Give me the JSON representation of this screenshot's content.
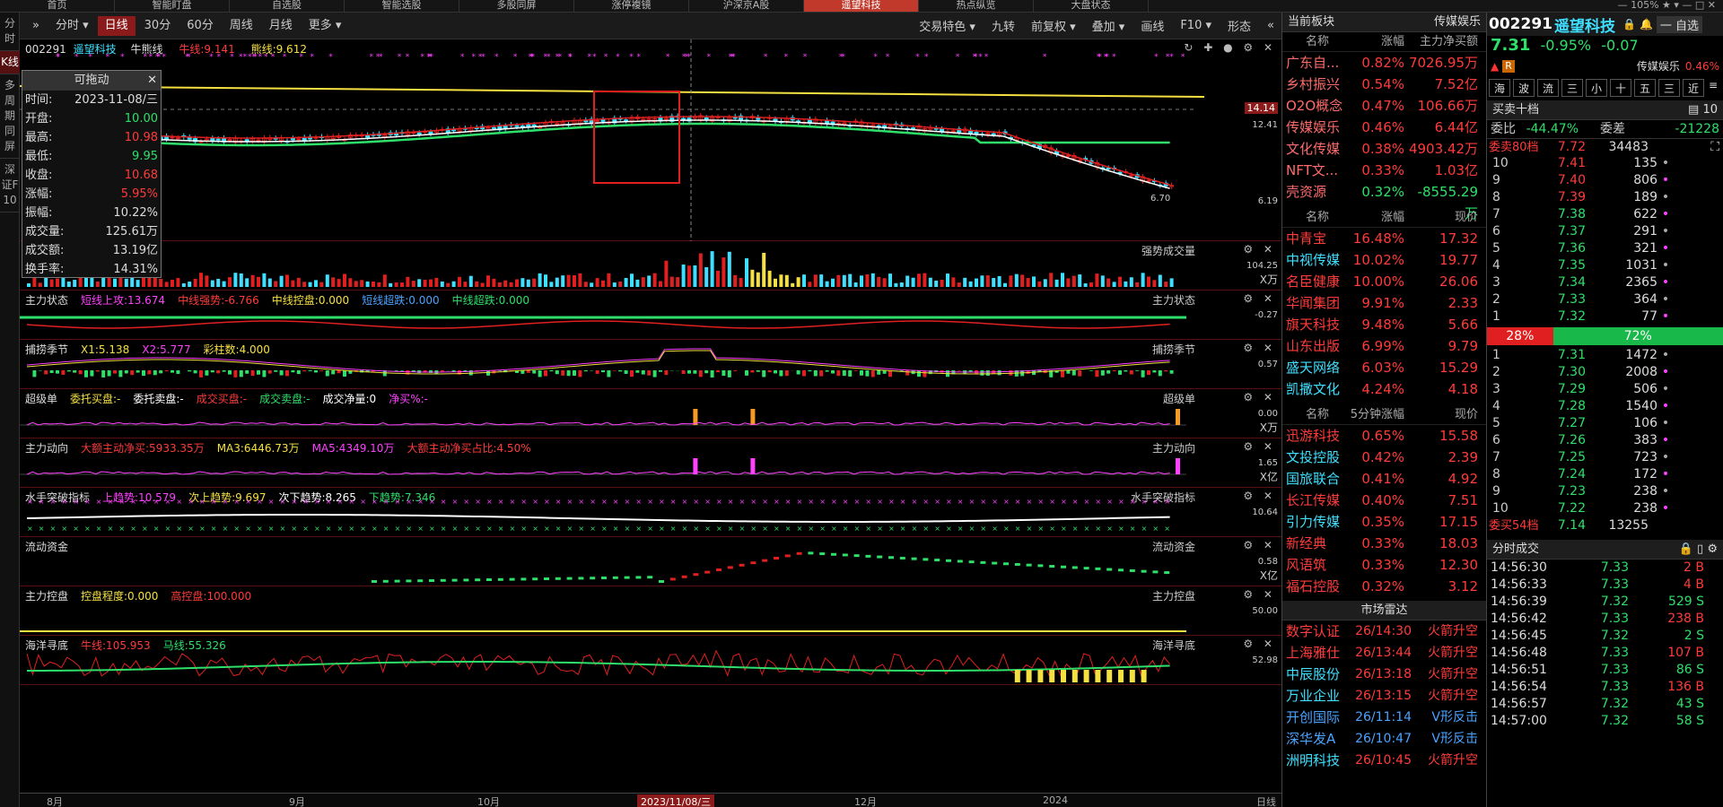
{
  "topbar": {
    "tabs": [
      "首页",
      "智能盯盘",
      "自选股",
      "智能选股",
      "多股同屏",
      "涨停複镜",
      "沪深京A股",
      "遥望科技",
      "热点纵览",
      "大盘状态"
    ],
    "active": 7,
    "right": "— 105% ★ ▾ — □ ✕"
  },
  "leftbar": [
    "分时",
    "K线",
    "多周期同屏",
    "深证F10"
  ],
  "toolbar": {
    "left": [
      "分时 ▾",
      "日线",
      "30分",
      "60分",
      "周线",
      "月线",
      "更多 ▾"
    ],
    "active": 1,
    "right": [
      "交易特色 ▾",
      "九转",
      "前复权 ▾",
      "叠加 ▾",
      "画线",
      "F10 ▾",
      "形态"
    ]
  },
  "main": {
    "code": "002291",
    "name": "遥望科技",
    "ind": "牛熊线",
    "bull": "牛线:9.141",
    "bear": "熊线:9.612",
    "yhi": "14.14",
    "y1": "12.41",
    "ylo": "6.19",
    "minlbl": "6.70"
  },
  "floatbox": {
    "title": "可拖动",
    "rows": [
      [
        "时间:",
        "2023-11-08/三"
      ],
      [
        "开盘:",
        "10.00"
      ],
      [
        "最高:",
        "10.98"
      ],
      [
        "最低:",
        "9.95"
      ],
      [
        "收盘:",
        "10.68"
      ],
      [
        "涨幅:",
        "5.95%"
      ],
      [
        "振幅:",
        "10.22%"
      ],
      [
        "成交量:",
        "125.61万"
      ],
      [
        "成交额:",
        "13.19亿"
      ],
      [
        "换手率:",
        "14.31%"
      ]
    ]
  },
  "panes": [
    {
      "title": "成交量",
      "right": "强势成交量",
      "y1": "104.25",
      "y2": "X万",
      "labels": []
    },
    {
      "title": "主力状态",
      "right": "主力状态",
      "y1": "-0.27",
      "labels": [
        [
          "短线上攻:13.674",
          "mag"
        ],
        [
          "中线强势:-6.766",
          "red"
        ],
        [
          "中线控盘:0.000",
          "yel"
        ],
        [
          "短线超跌:0.000",
          "blu"
        ],
        [
          "中线超跌:0.000",
          "grn"
        ]
      ]
    },
    {
      "title": "捕捞季节",
      "right": "捕捞季节",
      "y1": "0.57",
      "labels": [
        [
          "X1:5.138",
          "yel"
        ],
        [
          "X2:5.777",
          "mag"
        ],
        [
          "彩柱数:4.000",
          "yel"
        ]
      ]
    },
    {
      "title": "超级单",
      "right": "超级单",
      "y1": "0.00",
      "y2": "X万",
      "labels": [
        [
          "委托买盘:-",
          "yel"
        ],
        [
          "委托卖盘:-",
          "wht"
        ],
        [
          "成交买盘:-",
          "red"
        ],
        [
          "成交卖盘:-",
          "grn"
        ],
        [
          "成交净量:0",
          "wht"
        ],
        [
          "净买%:-",
          "mag"
        ]
      ]
    },
    {
      "title": "主力动向",
      "right": "主力动向",
      "y1": "1.65",
      "y2": "X亿",
      "labels": [
        [
          "大额主动净买:5933.35万",
          "red"
        ],
        [
          "MA3:6446.73万",
          "yel"
        ],
        [
          "MA5:4349.10万",
          "mag"
        ],
        [
          "大额主动净买占比:4.50%",
          "red"
        ]
      ]
    },
    {
      "title": "水手突破指标",
      "right": "水手突破指标",
      "y1": "10.64",
      "labels": [
        [
          "上趋势:10.579",
          "mag"
        ],
        [
          "次上趋势:9.697",
          "yel"
        ],
        [
          "次下趋势:8.265",
          "wht"
        ],
        [
          "下趋势:7.346",
          "grn"
        ]
      ]
    },
    {
      "title": "流动资金",
      "right": "流动资金",
      "y1": "0.58",
      "y2": "X亿",
      "labels": []
    },
    {
      "title": "主力控盘",
      "right": "主力控盘",
      "y1": "50.00",
      "labels": [
        [
          "控盘程度:0.000",
          "yel"
        ],
        [
          "高控盘:100.000",
          "red"
        ]
      ]
    },
    {
      "title": "海洋寻底",
      "right": "海洋寻底",
      "y1": "52.98",
      "labels": [
        [
          "牛线:105.953",
          "red"
        ],
        [
          "马线:55.326",
          "grn"
        ]
      ]
    }
  ],
  "xaxis": {
    "labels": [
      "8月",
      "9月",
      "10月",
      "2023/11/08/三",
      "12月",
      "2024"
    ],
    "right": "日线"
  },
  "sectors": {
    "head": "当前板块",
    "sub": "传媒娱乐",
    "cols": [
      "名称",
      "涨幅",
      "主力净买额"
    ],
    "rows": [
      [
        "广东自...",
        "0.82%",
        "7026.95万",
        "red"
      ],
      [
        "乡村振兴",
        "0.54%",
        "7.52亿",
        "red"
      ],
      [
        "O2O概念",
        "0.47%",
        "106.66万",
        "red"
      ],
      [
        "传媒娱乐",
        "0.46%",
        "6.44亿",
        "red"
      ],
      [
        "文化传媒",
        "0.38%",
        "4903.42万",
        "red"
      ],
      [
        "NFT文...",
        "0.33%",
        "1.03亿",
        "red"
      ],
      [
        "壳资源",
        "0.32%",
        "-8555.29万",
        "grn"
      ]
    ]
  },
  "gainers": {
    "cols": [
      "名称",
      "涨幅",
      "现价"
    ],
    "rows": [
      [
        "中青宝",
        "16.48%",
        "17.32",
        "red"
      ],
      [
        "中视传媒",
        "10.02%",
        "19.77",
        "cyn"
      ],
      [
        "名臣健康",
        "10.00%",
        "26.06",
        "red"
      ],
      [
        "华闻集团",
        "9.91%",
        "2.33",
        "red"
      ],
      [
        "旗天科技",
        "9.48%",
        "5.66",
        "red"
      ],
      [
        "山东出版",
        "6.99%",
        "9.79",
        "red"
      ],
      [
        "盛天网络",
        "6.03%",
        "15.29",
        "cyn"
      ],
      [
        "凯撒文化",
        "4.24%",
        "4.18",
        "cyn"
      ]
    ]
  },
  "fivemin": {
    "cols": [
      "名称",
      "5分钟涨幅",
      "现价"
    ],
    "rows": [
      [
        "迅游科技",
        "0.65%",
        "15.58",
        "red"
      ],
      [
        "文投控股",
        "0.42%",
        "2.39",
        "cyn"
      ],
      [
        "国旅联合",
        "0.41%",
        "4.92",
        "cyn"
      ],
      [
        "长江传媒",
        "0.40%",
        "7.51",
        "red"
      ],
      [
        "引力传媒",
        "0.35%",
        "17.15",
        "cyn"
      ],
      [
        "新经典",
        "0.33%",
        "18.03",
        "red"
      ],
      [
        "风语筑",
        "0.33%",
        "12.30",
        "red"
      ],
      [
        "福石控股",
        "0.32%",
        "3.12",
        "red"
      ]
    ]
  },
  "radar": {
    "head": "市场雷达",
    "rows": [
      [
        "数字认证",
        "26/14:30",
        "火箭升空",
        "red"
      ],
      [
        "上海雅仕",
        "26/13:44",
        "火箭升空",
        "red"
      ],
      [
        "中辰股份",
        "26/13:18",
        "火箭升空",
        "cyn"
      ],
      [
        "万业企业",
        "26/13:15",
        "火箭升空",
        "cyn"
      ],
      [
        "开创国际",
        "26/11:14",
        "V形反击",
        "blu"
      ],
      [
        "深华发A",
        "26/10:47",
        "V形反击",
        "blu"
      ],
      [
        "洲明科技",
        "26/10:45",
        "火箭升空",
        "cyn"
      ]
    ]
  },
  "stock": {
    "code": "002291",
    "name": "遥望科技",
    "price": "7.31",
    "pct": "-0.95%",
    "chg": "-0.07",
    "tag": "传媒娱乐",
    "tagpct": "0.46%",
    "self": "一 自选",
    "tabs": [
      "海",
      "波",
      "流",
      "三",
      "小",
      "十",
      "五",
      "三",
      "近"
    ]
  },
  "orderbook": {
    "title": "买卖十档",
    "wb": "委比",
    "wbv": "-44.47%",
    "wc": "委差",
    "wcv": "-21228",
    "sellhead": [
      "委卖80档",
      "7.72",
      "34483"
    ],
    "sells": [
      [
        "10",
        "7.41",
        "135",
        "•"
      ],
      [
        "9",
        "7.40",
        "806",
        "•"
      ],
      [
        "8",
        "7.39",
        "189",
        "•"
      ],
      [
        "7",
        "7.38",
        "622",
        "•"
      ],
      [
        "6",
        "7.37",
        "291",
        "•"
      ],
      [
        "5",
        "7.36",
        "321",
        "•"
      ],
      [
        "4",
        "7.35",
        "1031",
        "•"
      ],
      [
        "3",
        "7.34",
        "2365",
        "•"
      ],
      [
        "2",
        "7.33",
        "364",
        "•"
      ],
      [
        "1",
        "7.32",
        "77",
        "•"
      ]
    ],
    "ratio_sell": "28%",
    "ratio_buy": "72%",
    "buys": [
      [
        "1",
        "7.31",
        "1472",
        "•"
      ],
      [
        "2",
        "7.30",
        "2008",
        "•"
      ],
      [
        "3",
        "7.29",
        "506",
        "•"
      ],
      [
        "4",
        "7.28",
        "1540",
        "•"
      ],
      [
        "5",
        "7.27",
        "106",
        "•"
      ],
      [
        "6",
        "7.26",
        "383",
        "•"
      ],
      [
        "7",
        "7.25",
        "723",
        "•"
      ],
      [
        "8",
        "7.24",
        "172",
        "•"
      ],
      [
        "9",
        "7.23",
        "238",
        "•"
      ],
      [
        "10",
        "7.22",
        "238",
        "•"
      ]
    ],
    "buyfoot": [
      "委买54档",
      "7.14",
      "13255"
    ]
  },
  "ticks": {
    "head": "分时成交",
    "rows": [
      [
        "14:56:30",
        "7.33",
        "2 B"
      ],
      [
        "14:56:33",
        "7.33",
        "4 B"
      ],
      [
        "14:56:39",
        "7.32",
        "529 S"
      ],
      [
        "14:56:42",
        "7.33",
        "238 B"
      ],
      [
        "14:56:45",
        "7.32",
        "2 S"
      ],
      [
        "14:56:48",
        "7.33",
        "107 B"
      ],
      [
        "14:56:51",
        "7.33",
        "86 S"
      ],
      [
        "14:56:54",
        "7.33",
        "136 B"
      ],
      [
        "14:56:57",
        "7.32",
        "43 S"
      ],
      [
        "14:57:00",
        "7.32",
        "58 S"
      ]
    ]
  }
}
